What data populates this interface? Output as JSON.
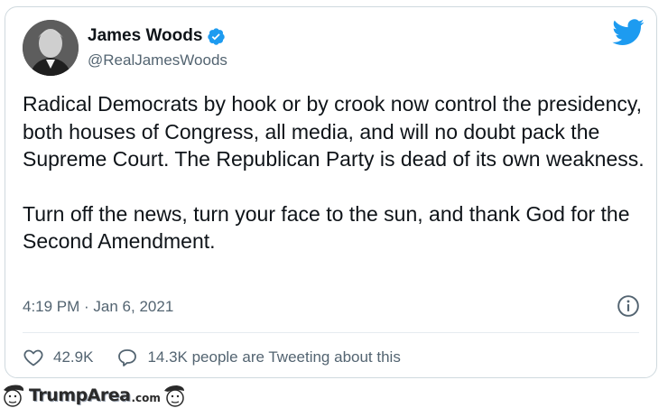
{
  "tweet": {
    "display_name": "James Woods",
    "handle": "@RealJamesWoods",
    "paragraphs": [
      "Radical Democrats by hook or by crook now control the presidency, both houses of Congress, all media, and will no doubt pack the Supreme Court. The Republican Party is dead of its own weakness.",
      "Turn off the news, turn your face to the sun, and thank God for the Second Amendment."
    ],
    "timestamp": "4:19 PM · Jan 6, 2021",
    "likes": "42.9K",
    "conversation": "14.3K people are Tweeting about this"
  },
  "watermark": {
    "brand": "TrumpArea",
    "suffix": ".com"
  },
  "colors": {
    "twitter_blue": "#1d9bf0",
    "text_primary": "#0f1419",
    "text_secondary": "#536471",
    "border": "#cfd9de"
  },
  "icons": {
    "verified": "verified-badge-icon",
    "twitter": "twitter-bird-icon",
    "info": "info-icon",
    "like": "heart-icon",
    "conversation": "speech-bubble-icon"
  }
}
